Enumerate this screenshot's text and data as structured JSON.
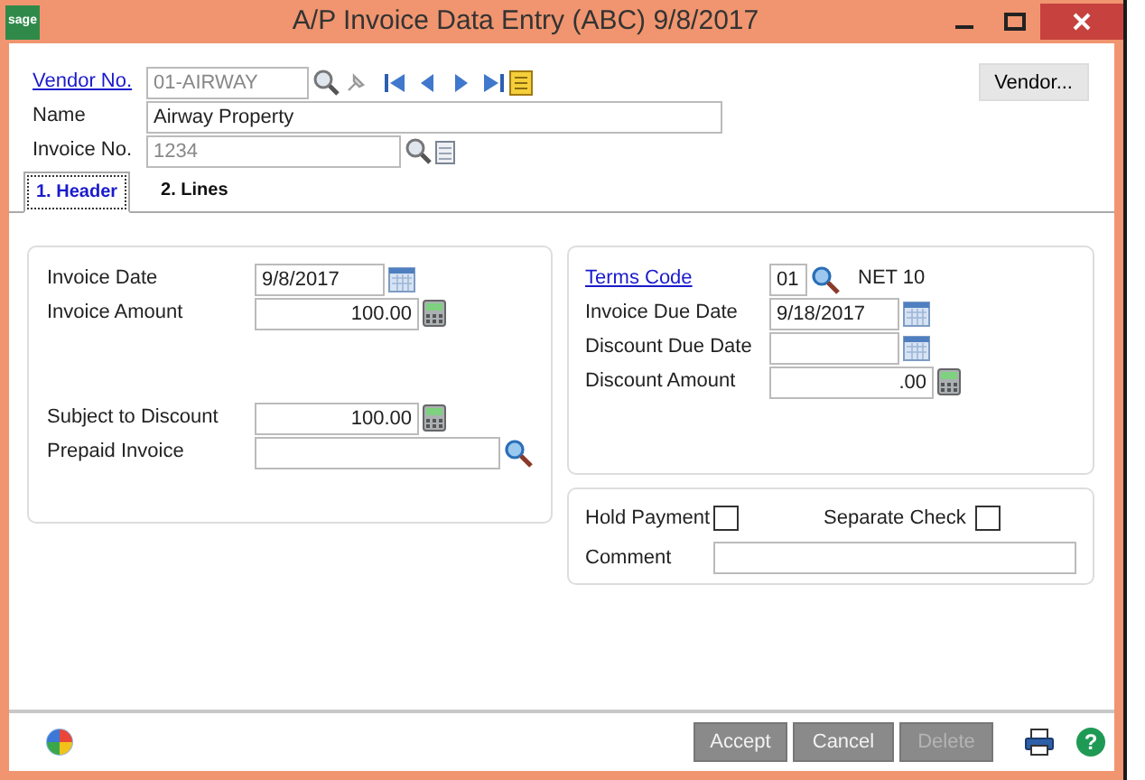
{
  "window": {
    "title": "A/P Invoice Data Entry (ABC) 9/8/2017",
    "logo": "sage"
  },
  "vendor": {
    "label": "Vendor No.",
    "value": "01-AIRWAY",
    "dimmed": true,
    "button": "Vendor..."
  },
  "name": {
    "label": "Name",
    "value": "Airway Property",
    "dimmed": false
  },
  "invoice_no": {
    "label": "Invoice No.",
    "value": "1234",
    "dimmed": true
  },
  "tabs": [
    {
      "label": "1. Header",
      "selected": true
    },
    {
      "label": "2. Lines",
      "selected": false
    }
  ],
  "left_panel": {
    "top": [
      {
        "label": "Invoice Date",
        "value": "9/8/2017",
        "kind": "date"
      },
      {
        "label": "Invoice Amount",
        "value": "100.00",
        "kind": "amount"
      }
    ],
    "bottom": [
      {
        "label": "Subject to Discount",
        "value": "100.00",
        "kind": "amount"
      },
      {
        "label": "Prepaid Invoice",
        "kind": "lookup"
      }
    ]
  },
  "terms": {
    "label": "Terms Code",
    "code": "01",
    "description": "NET 10"
  },
  "due_fields": [
    {
      "label": "Invoice Due Date",
      "value": "9/18/2017",
      "kind": "date"
    },
    {
      "label": "Discount Due Date",
      "kind": "date"
    },
    {
      "label": "Discount Amount",
      "value": ".00",
      "kind": "amount"
    }
  ],
  "options": [
    {
      "label": "Hold Payment",
      "checked": false
    },
    {
      "label": "Separate Check",
      "checked": false
    }
  ],
  "comment": {
    "label": "Comment"
  },
  "buttons": [
    {
      "label": "Accept",
      "disabled": false
    },
    {
      "label": "Cancel",
      "disabled": false
    },
    {
      "label": "Delete",
      "disabled": true
    }
  ],
  "help": "?"
}
